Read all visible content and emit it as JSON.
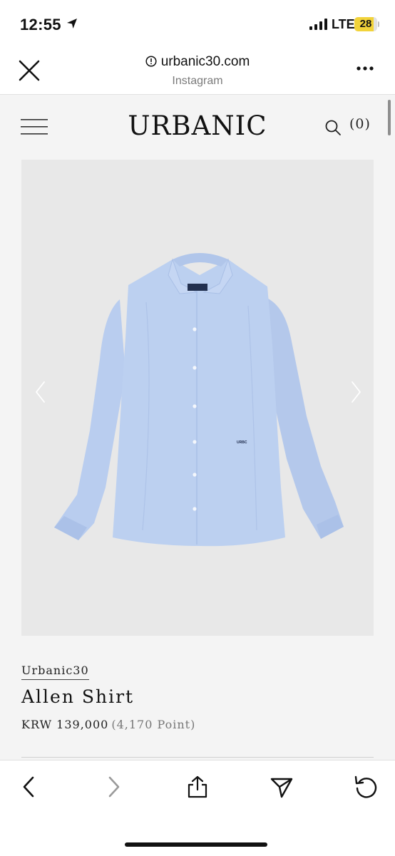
{
  "status_bar": {
    "time": "12:55",
    "network": "LTE",
    "battery": "28"
  },
  "browser": {
    "domain": "urbanic30.com",
    "source": "Instagram"
  },
  "site": {
    "logo": "URBANIC",
    "cart": "(0)"
  },
  "product": {
    "brand": "Urbanic30",
    "name": "Allen Shirt",
    "price": "KRW 139,000",
    "points": "(4,170 Point)",
    "shirt_label": "URBC"
  },
  "icons": {
    "close": "close-icon",
    "info": "info-icon",
    "more": "more-icon",
    "menu": "hamburger-icon",
    "search": "search-icon",
    "back": "chevron-left-icon",
    "forward": "chevron-right-icon",
    "share": "share-icon",
    "send": "send-icon",
    "reload": "reload-icon"
  },
  "colors": {
    "shirt": "#b9cdef",
    "image_bg": "#e8e8e8",
    "battery": "#f2d33a"
  }
}
